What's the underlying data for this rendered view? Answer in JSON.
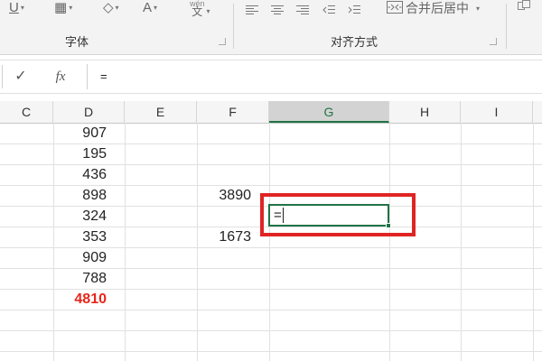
{
  "ribbon": {
    "font_group_label": "字体",
    "alignment_group_label": "对齐方式",
    "underline_label": "U",
    "font_color_label": "A",
    "phonetic_label": "wén",
    "phonetic_char": "文",
    "merge_center_label": "合并后居中",
    "icons": [
      "underline-icon",
      "border-icon",
      "fill-color-icon",
      "font-color-icon",
      "phonetic-icon",
      "align-left-icon",
      "align-center-icon",
      "align-right-icon",
      "decrease-indent-icon",
      "increase-indent-icon",
      "merge-center-icon",
      "dialog-launcher-icon"
    ]
  },
  "formula_bar": {
    "enter_symbol": "✓",
    "function_symbol": "fx",
    "value": "="
  },
  "columns": [
    {
      "label": "C",
      "selected": false
    },
    {
      "label": "D",
      "selected": false
    },
    {
      "label": "E",
      "selected": false
    },
    {
      "label": "F",
      "selected": false
    },
    {
      "label": "G",
      "selected": true
    },
    {
      "label": "H",
      "selected": false
    },
    {
      "label": "I",
      "selected": false
    }
  ],
  "cells": {
    "D": [
      "907",
      "195",
      "436",
      "898",
      "324",
      "353",
      "909",
      "788",
      "4810"
    ],
    "F": [
      "",
      "",
      "",
      "3890",
      "",
      "1673",
      "",
      "",
      ""
    ],
    "active_value": "="
  },
  "colors": {
    "accent_green": "#217346",
    "highlight_red": "#e02424",
    "total_red": "#e8261b"
  }
}
